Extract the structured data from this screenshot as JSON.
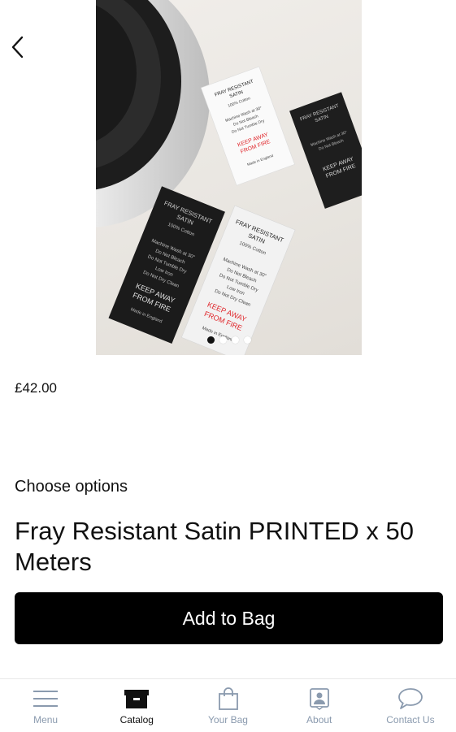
{
  "header": {
    "back_icon": "chevron-left-icon"
  },
  "product": {
    "image_alt": "Fray resistant satin printed care labels",
    "image_slides": 4,
    "active_slide": 1,
    "label_texts": {
      "line1": "FRAY RESISTANT",
      "line2": "SATIN",
      "line3": "100% Cotton",
      "line4": "Machine Wash at 30°",
      "line5": "Do Not Bleach",
      "line6": "Do Not Tumble Dry",
      "line7": "Low Iron",
      "line8": "Do Not Dry Clean",
      "warn1": "KEEP AWAY",
      "warn2": "FROM FIRE",
      "made": "Made in England"
    },
    "price": "£42.00",
    "options_label": "Choose options",
    "title": "Fray Resistant Satin PRINTED x 50 Meters",
    "add_button_label": "Add to Bag"
  },
  "tabbar": {
    "items": [
      {
        "label": "Menu",
        "icon": "menu-icon",
        "active": false
      },
      {
        "label": "Catalog",
        "icon": "catalog-icon",
        "active": true
      },
      {
        "label": "Your Bag",
        "icon": "bag-icon",
        "active": false
      },
      {
        "label": "About",
        "icon": "about-icon",
        "active": false
      },
      {
        "label": "Contact Us",
        "icon": "chat-icon",
        "active": false
      }
    ]
  },
  "colors": {
    "accent": "#000000",
    "tab_inactive": "#8a9aae",
    "tab_active": "#111111",
    "warning_red": "#e0262b"
  }
}
